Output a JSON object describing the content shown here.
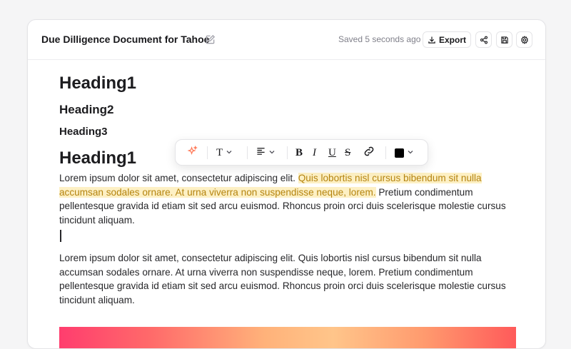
{
  "header": {
    "title": "Due Dilligence Document for Tahoe",
    "saved_status": "Saved 5 seconds ago",
    "export_label": "Export"
  },
  "document": {
    "heading1_a": "Heading1",
    "heading2": "Heading2",
    "heading3": "Heading3",
    "heading1_b": "Heading1",
    "para1_before": "Lorem ipsum dolor sit amet, consectetur adipiscing elit. ",
    "para1_highlight": "Quis lobortis nisl cursus bibendum sit nulla accumsan sodales ornare. At urna viverra non suspendisse neque, lorem.",
    "para1_after": " Pretium condimentum pellentesque gravida id etiam sit sed arcu euismod. Rhoncus proin orci duis scelerisque molestie cursus tincidunt aliquam.",
    "para2": "Lorem ipsum dolor sit amet, consectetur adipiscing elit. Quis lobortis nisl cursus bibendum sit nulla accumsan sodales ornare. At urna viverra non suspendisse neque, lorem. Pretium condimentum pellentesque gravida id etiam sit sed arcu euismod. Rhoncus proin orci duis scelerisque molestie cursus tincidunt aliquam."
  },
  "toolbar": {
    "text_style_glyph": "T",
    "bold": "B",
    "italic": "I",
    "underline": "U",
    "strike": "S",
    "current_color": "#000000"
  },
  "colors": {
    "accent_ai": "#ff7a59",
    "highlight_bg": "#fdf0c4",
    "highlight_text": "#b58410"
  },
  "icons": [
    "edit-icon",
    "download-icon",
    "share-icon",
    "save-icon",
    "gear-icon",
    "sparkle-icon",
    "align-icon",
    "link-icon",
    "chevron-down-icon"
  ]
}
